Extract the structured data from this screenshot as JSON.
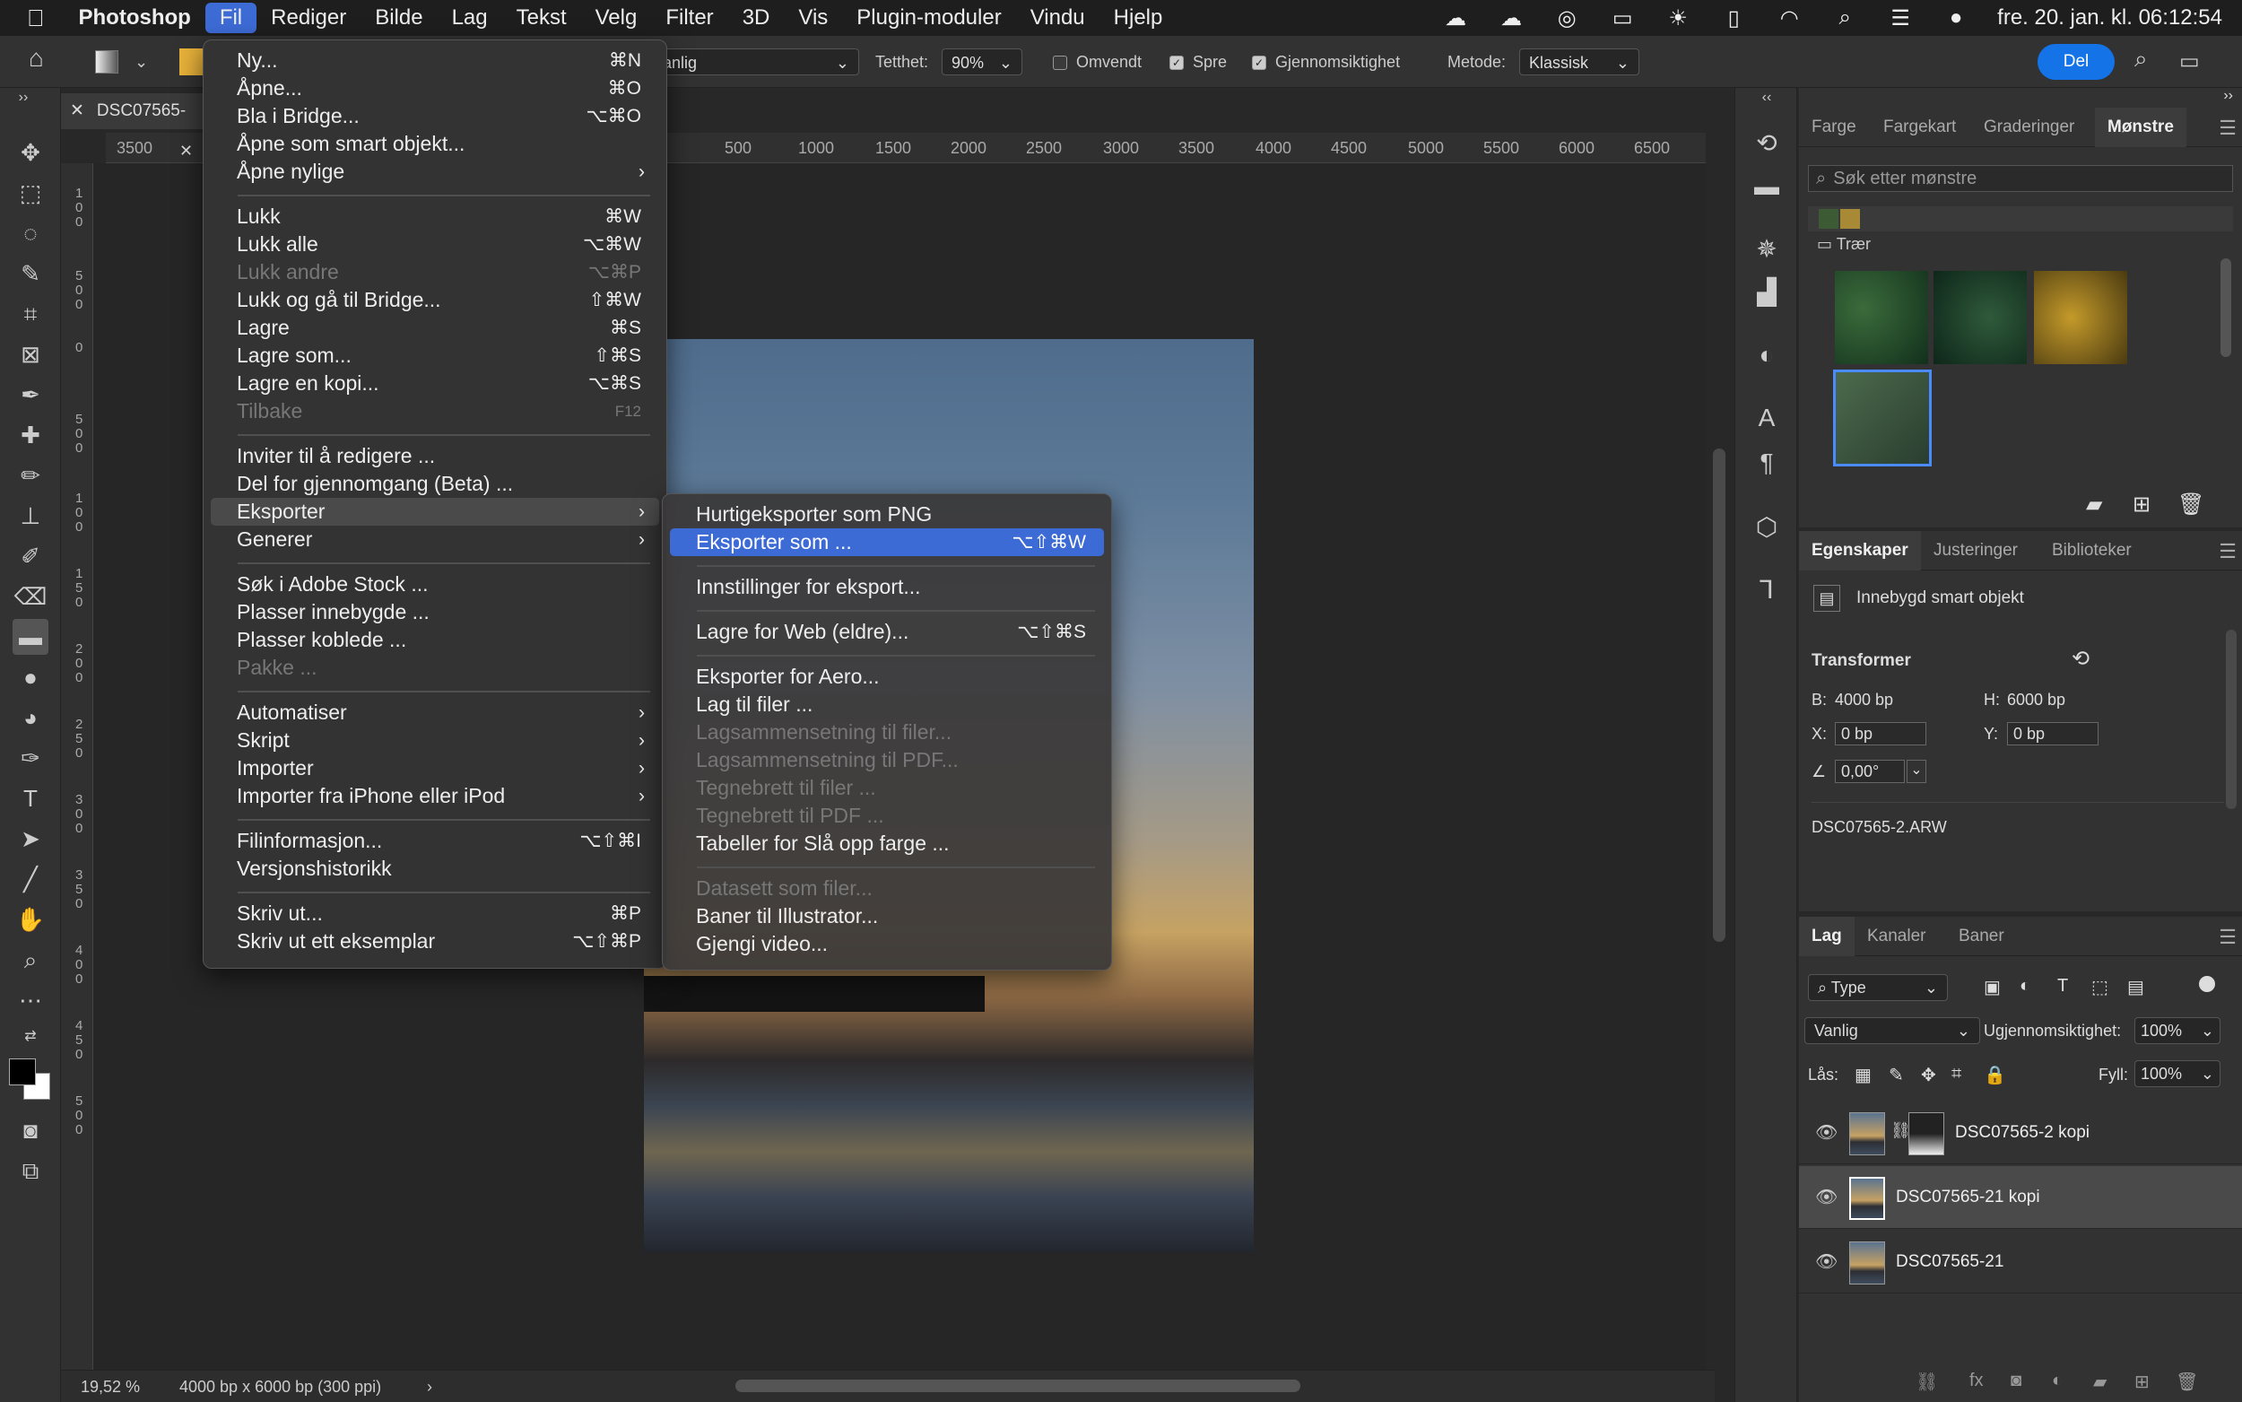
{
  "menubar": {
    "app": "Photoshop",
    "items": [
      "Fil",
      "Rediger",
      "Bilde",
      "Lag",
      "Tekst",
      "Velg",
      "Filter",
      "3D",
      "Vis",
      "Plugin-moduler",
      "Vindu",
      "Hjelp"
    ],
    "datetime": "fre. 20. jan. kl. 06:12:54"
  },
  "options": {
    "mode_value": "anlig",
    "density_label": "Tetthet:",
    "density_value": "90%",
    "reverse_label": "Omvendt",
    "dither_label": "Spre",
    "transparency_label": "Gjennomsiktighet",
    "method_label": "Metode:",
    "method_value": "Klassisk",
    "share_label": "Del"
  },
  "document": {
    "tab_title": "DSC07565-",
    "zoom": "19,52 %",
    "size_info": "4000 bp x 6000 bp (300 ppi)",
    "ruler_h": [
      "3500",
      "500",
      "1000",
      "1500",
      "2000",
      "2500",
      "3000",
      "3500",
      "4000",
      "4500",
      "5000",
      "5500",
      "6000",
      "6500"
    ],
    "ruler_v": [
      "1\n0\n0",
      "5\n0\n0",
      "0",
      "5\n0\n0",
      "1\n0\n0",
      "1\n5\n0",
      "2\n0\n0",
      "2\n5\n0",
      "3\n0\n0",
      "3\n5\n0",
      "4\n0\n0",
      "4\n5\n0",
      "5\n0\n0"
    ]
  },
  "file_menu": {
    "items": [
      {
        "label": "Ny...",
        "shortcut": "⌘N"
      },
      {
        "label": "Åpne...",
        "shortcut": "⌘O"
      },
      {
        "label": "Bla i Bridge...",
        "shortcut": "⌥⌘O"
      },
      {
        "label": "Åpne som smart objekt...",
        "shortcut": ""
      },
      {
        "label": "Åpne nylige",
        "shortcut": "›"
      },
      {
        "label": "Lukk",
        "shortcut": "⌘W"
      },
      {
        "label": "Lukk alle",
        "shortcut": "⌥⌘W"
      },
      {
        "label": "Lukk andre",
        "shortcut": "⌥⌘P"
      },
      {
        "label": "Lukk og gå til Bridge...",
        "shortcut": "⇧⌘W"
      },
      {
        "label": "Lagre",
        "shortcut": "⌘S"
      },
      {
        "label": "Lagre som...",
        "shortcut": "⇧⌘S"
      },
      {
        "label": "Lagre en kopi...",
        "shortcut": "⌥⌘S"
      },
      {
        "label": "Tilbake",
        "shortcut": "F12"
      },
      {
        "label": "Inviter til å redigere ...",
        "shortcut": ""
      },
      {
        "label": "Del for gjennomgang (Beta) ...",
        "shortcut": ""
      },
      {
        "label": "Eksporter",
        "shortcut": "›"
      },
      {
        "label": "Generer",
        "shortcut": "›"
      },
      {
        "label": "Søk i Adobe Stock ...",
        "shortcut": ""
      },
      {
        "label": "Plasser innebygde ...",
        "shortcut": ""
      },
      {
        "label": "Plasser koblede ...",
        "shortcut": ""
      },
      {
        "label": "Pakke ...",
        "shortcut": ""
      },
      {
        "label": "Automatiser",
        "shortcut": "›"
      },
      {
        "label": "Skript",
        "shortcut": "›"
      },
      {
        "label": "Importer",
        "shortcut": "›"
      },
      {
        "label": "Importer fra iPhone eller iPod",
        "shortcut": "›"
      },
      {
        "label": "Filinformasjon...",
        "shortcut": "⌥⇧⌘I"
      },
      {
        "label": "Versjonshistorikk",
        "shortcut": ""
      },
      {
        "label": "Skriv ut...",
        "shortcut": "⌘P"
      },
      {
        "label": "Skriv ut ett eksemplar",
        "shortcut": "⌥⇧⌘P"
      }
    ]
  },
  "export_menu": {
    "items": [
      {
        "label": "Hurtigeksporter som PNG",
        "shortcut": ""
      },
      {
        "label": "Eksporter som ...",
        "shortcut": "⌥⇧⌘W"
      },
      {
        "label": "Innstillinger for eksport...",
        "shortcut": ""
      },
      {
        "label": "Lagre for Web (eldre)...",
        "shortcut": "⌥⇧⌘S"
      },
      {
        "label": "Eksporter for Aero...",
        "shortcut": ""
      },
      {
        "label": "Lag til filer ...",
        "shortcut": ""
      },
      {
        "label": "Lagsammensetning til filer...",
        "shortcut": ""
      },
      {
        "label": "Lagsammensetning til PDF...",
        "shortcut": ""
      },
      {
        "label": "Tegnebrett til filer ...",
        "shortcut": ""
      },
      {
        "label": "Tegnebrett til PDF ...",
        "shortcut": ""
      },
      {
        "label": "Tabeller for Slå opp farge ...",
        "shortcut": ""
      },
      {
        "label": "Datasett som filer...",
        "shortcut": ""
      },
      {
        "label": "Baner til Illustrator...",
        "shortcut": ""
      },
      {
        "label": "Gjengi video...",
        "shortcut": ""
      }
    ]
  },
  "patterns_panel": {
    "tabs": [
      "Farge",
      "Fargekart",
      "Graderinger",
      "Mønstre"
    ],
    "search_placeholder": "Søk etter mønstre",
    "group_name": "Trær"
  },
  "properties_panel": {
    "tabs": [
      "Egenskaper",
      "Justeringer",
      "Biblioteker"
    ],
    "object_type": "Innebygd smart objekt",
    "transform_title": "Transformer",
    "w_label": "B:",
    "w_value": "4000 bp",
    "h_label": "H:",
    "h_value": "6000 bp",
    "x_label": "X:",
    "x_value": "0 bp",
    "y_label": "Y:",
    "y_value": "0 bp",
    "angle_value": "0,00°",
    "filename": "DSC07565-2.ARW"
  },
  "layers_panel": {
    "tabs": [
      "Lag",
      "Kanaler",
      "Baner"
    ],
    "filter_value": "Type",
    "blend_value": "Vanlig",
    "opacity_label": "Ugjennomsiktighet:",
    "opacity_value": "100%",
    "lock_label": "Lås:",
    "fill_label": "Fyll:",
    "fill_value": "100%",
    "layers": [
      {
        "name": "DSC07565-2 kopi"
      },
      {
        "name": "DSC07565-21 kopi"
      },
      {
        "name": "DSC07565-21"
      }
    ]
  },
  "colors": {
    "accent": "#3d6bd6",
    "share": "#1473e6"
  }
}
